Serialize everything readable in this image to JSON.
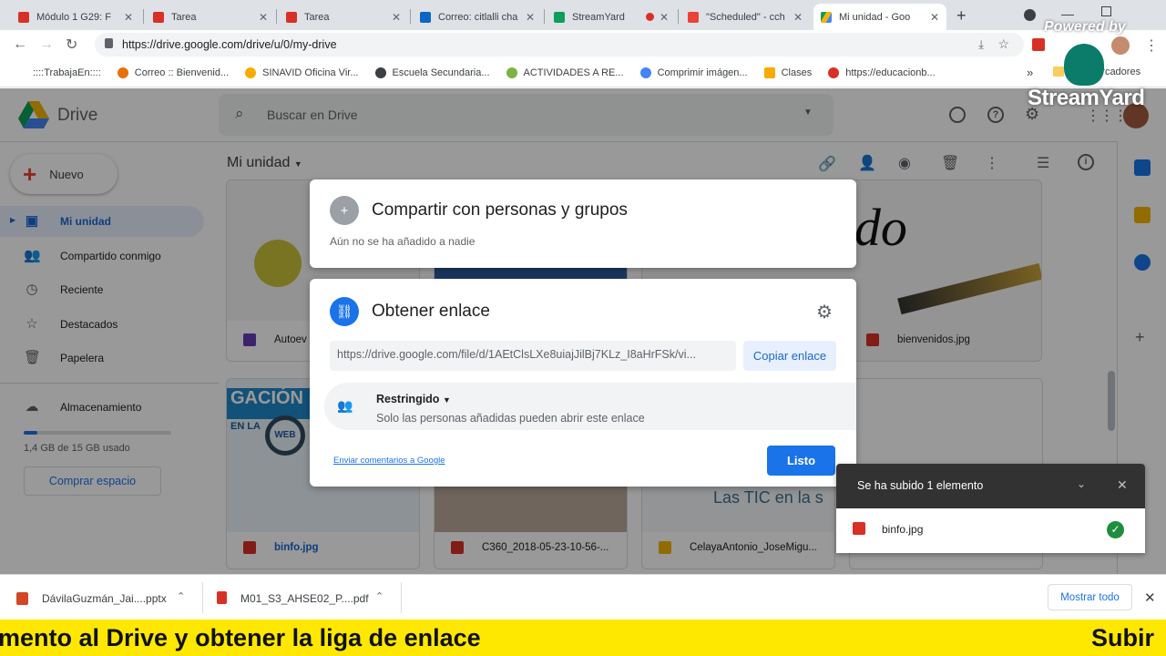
{
  "browser": {
    "tabs": [
      {
        "title": "Módulo 1 G29: F",
        "color": "#d93025"
      },
      {
        "title": "Tarea",
        "color": "#d93025"
      },
      {
        "title": "Tarea",
        "color": "#d93025"
      },
      {
        "title": "Correo: citlalli cha",
        "color": "#0a66c2"
      },
      {
        "title": "StreamYard",
        "color": "#0f9d58"
      },
      {
        "title": "\"Scheduled\" - cch",
        "color": "#ea4335"
      },
      {
        "title": "Mi unidad - Goo",
        "color": "#1a73e8"
      }
    ],
    "new_tab": "+",
    "url": "https://drive.google.com/drive/u/0/my-drive",
    "bookmarks": [
      {
        "label": "::::TrabajaEn::::",
        "color": "#202124"
      },
      {
        "label": "Correo :: Bienvenid...",
        "color": "#e8710a"
      },
      {
        "label": "SINAVID Oficina Vir...",
        "color": "#f9ab00"
      },
      {
        "label": "Escuela Secundaria...",
        "color": "#3c4043"
      },
      {
        "label": "ACTIVIDADES A RE...",
        "color": "#7cb342"
      },
      {
        "label": "Comprimir imágen...",
        "color": "#4285f4"
      },
      {
        "label": "Clases",
        "color": "#f9ab00"
      },
      {
        "label": "https://educacionb...",
        "color": "#d93025"
      }
    ],
    "bookmarks_folder": "Marcadores",
    "overflow": "»"
  },
  "streamyard": {
    "powered": "Powered by",
    "brand": "StreamYard"
  },
  "drive": {
    "logo": "Drive",
    "search_placeholder": "Buscar en Drive",
    "new_button": "Nuevo",
    "nav": [
      "Mi unidad",
      "Compartido conmigo",
      "Reciente",
      "Destacados",
      "Papelera"
    ],
    "storage_label": "Almacenamiento",
    "storage_used": "1,4 GB de 15 GB usado",
    "storage_fraction": 0.093,
    "buy_storage": "Comprar espacio",
    "breadcrumb": "Mi unidad",
    "files": [
      {
        "name": "Autoev",
        "icon_color": "#673ab7"
      },
      {
        "name": "bienvenidos.jpg",
        "icon_color": "#d93025"
      },
      {
        "name": "binfo.jpg",
        "icon_color": "#d93025"
      },
      {
        "name": "C360_2018-05-23-10-56-...",
        "icon_color": "#d93025"
      },
      {
        "name": "CelayaAntonio_JoseMigu...",
        "icon_color": "#f4b400"
      }
    ],
    "thumb_texts": {
      "bienvenidos": "Bienvenido",
      "gacion": "GACIÓN",
      "enla": "EN LA",
      "web": "WEB",
      "tics": "Las TIC en la s"
    }
  },
  "share_dialog": {
    "title": "Compartir con personas y grupos",
    "subtitle": "Aún no se ha añadido a nadie"
  },
  "link_dialog": {
    "title": "Obtener enlace",
    "url": "https://drive.google.com/file/d/1AEtClsLXe8uiajJilBj7KLz_I8aHrFSk/vi...",
    "copy_button": "Copiar enlace",
    "access_label": "Restringido",
    "access_desc": "Solo las personas añadidas pueden abrir este enlace",
    "feedback_link": "Enviar comentarios a Google",
    "done_button": "Listo"
  },
  "upload_toast": {
    "title": "Se ha subido 1 elemento",
    "file": "binfo.jpg"
  },
  "downloads": {
    "items": [
      {
        "name": "DávilaGuzmán_Jai....pptx",
        "color": "#d24726"
      },
      {
        "name": "M01_S3_AHSE02_P....pdf",
        "color": "#d93025"
      }
    ],
    "show_all": "Mostrar todo"
  },
  "banner": {
    "left": "mento al Drive y obtener la liga de enlace",
    "right": "Subir"
  }
}
